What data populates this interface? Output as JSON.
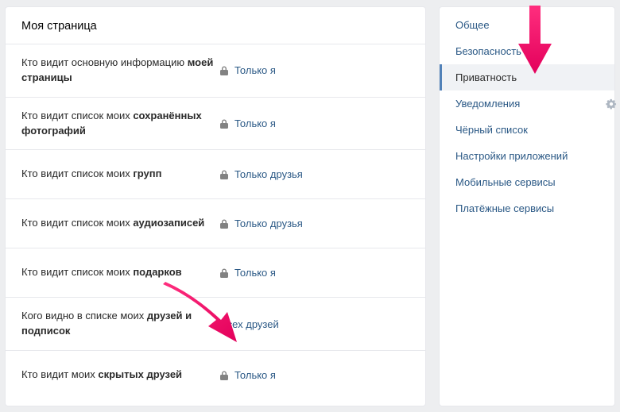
{
  "section_title": "Моя страница",
  "rows": [
    {
      "label_pre": "Кто видит основную информацию ",
      "label_bold": "моей страницы",
      "value": "Только я",
      "locked": true
    },
    {
      "label_pre": "Кто видит список моих ",
      "label_bold": "сохранённых фотографий",
      "value": "Только я",
      "locked": true
    },
    {
      "label_pre": "Кто видит список моих ",
      "label_bold": "групп",
      "value": "Только друзья",
      "locked": true
    },
    {
      "label_pre": "Кто видит список моих ",
      "label_bold": "аудиозаписей",
      "value": "Только друзья",
      "locked": true
    },
    {
      "label_pre": "Кто видит список моих ",
      "label_bold": "подарков",
      "value": "Только я",
      "locked": true
    },
    {
      "label_pre": "Кого видно в списке моих ",
      "label_bold": "друзей и подписок",
      "value": "Всех друзей",
      "locked": false
    },
    {
      "label_pre": "Кто видит моих ",
      "label_bold": "скрытых друзей",
      "value": "Только я",
      "locked": true
    }
  ],
  "sidebar": {
    "items": [
      {
        "label": "Общее",
        "active": false
      },
      {
        "label": "Безопасность",
        "active": false
      },
      {
        "label": "Приватность",
        "active": true
      },
      {
        "label": "Уведомления",
        "active": false,
        "gear": true
      },
      {
        "label": "Чёрный список",
        "active": false
      },
      {
        "label": "Настройки приложений",
        "active": false
      },
      {
        "label": "Мобильные сервисы",
        "active": false
      },
      {
        "label": "Платёжные сервисы",
        "active": false
      }
    ]
  }
}
